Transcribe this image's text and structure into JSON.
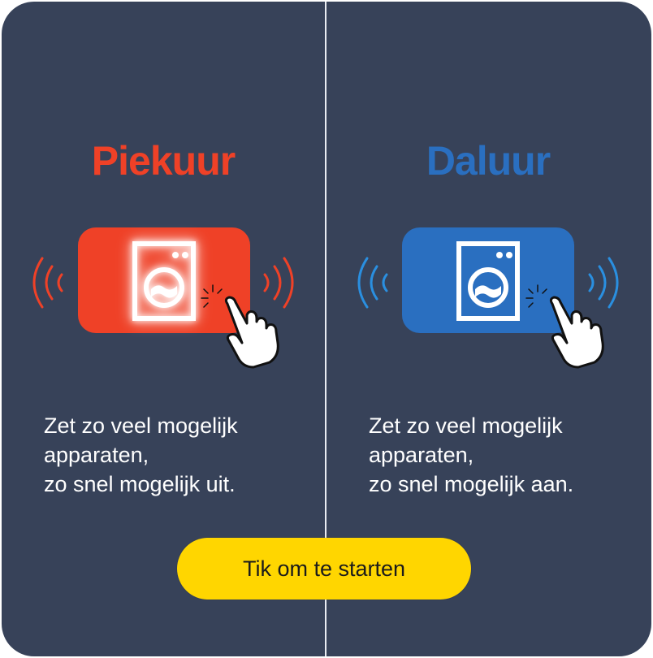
{
  "colors": {
    "background": "#374259",
    "peak": "#ef4127",
    "offpeak": "#2a6fc0",
    "button": "#ffd600",
    "text": "#ffffff"
  },
  "left_panel": {
    "title": "Piekuur",
    "icon": "washing-machine-icon",
    "description_lines": [
      "Zet zo veel mogelijk",
      "apparaten,",
      "zo snel mogelijk uit."
    ]
  },
  "right_panel": {
    "title": "Daluur",
    "icon": "washing-machine-icon",
    "description_lines": [
      "Zet zo veel mogelijk",
      "apparaten,",
      "zo snel mogelijk aan."
    ]
  },
  "start_button": {
    "label": "Tik om te starten"
  }
}
